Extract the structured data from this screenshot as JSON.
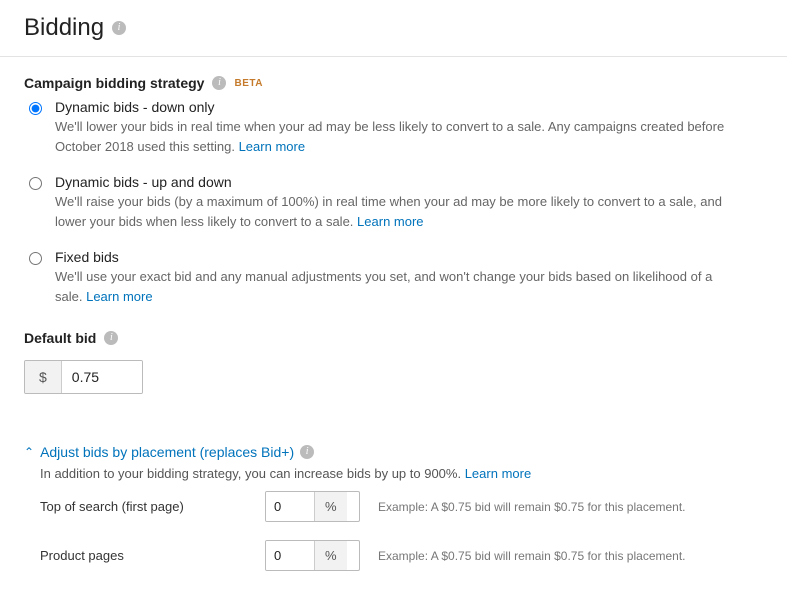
{
  "page": {
    "title": "Bidding"
  },
  "strategy": {
    "heading": "Campaign bidding strategy",
    "badge": "BETA",
    "options": [
      {
        "label": "Dynamic bids - down only",
        "desc": "We'll lower your bids in real time when your ad may be less likely to convert to a sale. Any campaigns created before October 2018 used this setting.",
        "learn": "Learn more",
        "selected": true
      },
      {
        "label": "Dynamic bids - up and down",
        "desc": "We'll raise your bids (by a maximum of 100%) in real time when your ad may be more likely to convert to a sale, and lower your bids when less likely to convert to a sale.",
        "learn": "Learn more",
        "selected": false
      },
      {
        "label": "Fixed bids",
        "desc": "We'll use your exact bid and any manual adjustments you set, and won't change your bids based on likelihood of a sale.",
        "learn": "Learn more",
        "selected": false
      }
    ]
  },
  "defaultBid": {
    "heading": "Default bid",
    "currency": "$",
    "value": "0.75"
  },
  "adjust": {
    "heading": "Adjust bids by placement (replaces Bid+)",
    "desc": "In addition to your bidding strategy, you can increase bids by up to 900%.",
    "learn": "Learn more",
    "pctSymbol": "%",
    "rows": [
      {
        "label": "Top of search (first page)",
        "value": "0",
        "example": "Example: A $0.75 bid will remain $0.75 for this placement."
      },
      {
        "label": "Product pages",
        "value": "0",
        "example": "Example: A $0.75 bid will remain $0.75 for this placement."
      }
    ]
  },
  "icons": {
    "info": "i",
    "caret": "⌃"
  }
}
